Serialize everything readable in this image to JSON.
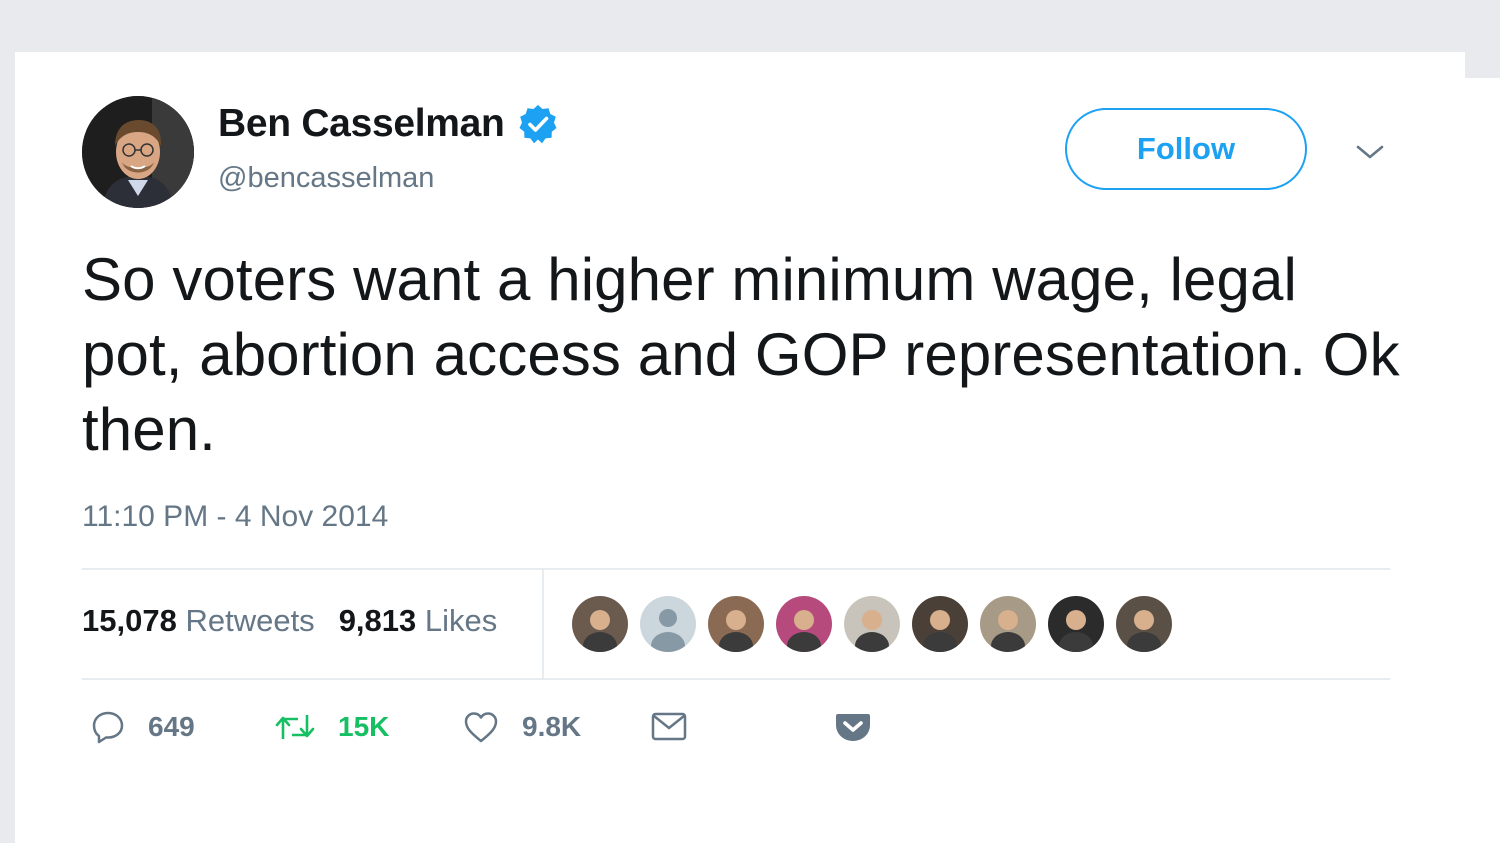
{
  "tweet": {
    "display_name": "Ben Casselman",
    "handle": "@bencasselman",
    "verified": true,
    "follow_label": "Follow",
    "text": "So voters want a higher minimum wage, legal pot, abortion access and GOP representation. Ok then.",
    "timestamp": "11:10 PM - 4 Nov 2014",
    "stats": {
      "retweets_count": "15,078",
      "retweets_label": "Retweets",
      "likes_count": "9,813",
      "likes_label": "Likes"
    },
    "likers": [
      {
        "name": "liker-1",
        "color": "#6b5a4e"
      },
      {
        "name": "liker-2-default",
        "color": "#ccd6dd"
      },
      {
        "name": "liker-3",
        "color": "#8a6a52"
      },
      {
        "name": "liker-4",
        "color": "#b64a7d"
      },
      {
        "name": "liker-5",
        "color": "#c9c4bb"
      },
      {
        "name": "liker-6",
        "color": "#4a4038"
      },
      {
        "name": "liker-7",
        "color": "#a79a86"
      },
      {
        "name": "liker-8",
        "color": "#2b2b2b"
      },
      {
        "name": "liker-9",
        "color": "#5a5046"
      }
    ],
    "actions": {
      "reply_count": "649",
      "retweet_count": "15K",
      "like_count": "9.8K"
    }
  },
  "colors": {
    "accent": "#1da1f2",
    "secondary_text": "#657786",
    "retweet_green": "#17bf63",
    "pocket_red": "#ef4056"
  }
}
